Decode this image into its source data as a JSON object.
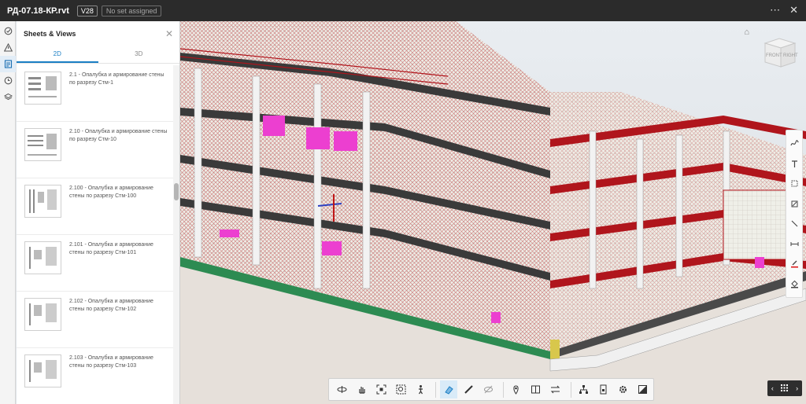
{
  "header": {
    "file_name": "РД-07.18-КР.rvt",
    "version": "V28",
    "set_status": "No set assigned",
    "more_icon": "more-horizontal-icon",
    "close_icon": "close-icon"
  },
  "rail": {
    "icons": [
      "check-circle-icon",
      "warning-icon",
      "sheets-icon",
      "history-icon",
      "layers-icon"
    ],
    "active": "sheets-icon"
  },
  "panel": {
    "title": "Sheets & Views",
    "tabs": [
      {
        "label": "2D",
        "active": true
      },
      {
        "label": "3D",
        "active": false
      }
    ],
    "items": [
      {
        "label": "2.1 - Опалубка и армирование стены по разрезу Стм-1"
      },
      {
        "label": "2.10 - Опалубка и армирование стены по разрезу Стм-10"
      },
      {
        "label": "2.100 - Опалубка и армирование стены по разрезу Стм-100"
      },
      {
        "label": "2.101 - Опалубка и армирование стены по разрезу Стм-101"
      },
      {
        "label": "2.102 - Опалубка и армирование стены по разрезу Стм-102"
      },
      {
        "label": "2.103 - Опалубка и армирование стены по разрезу Стм-103"
      }
    ]
  },
  "viewcube": {
    "front": "FRONT",
    "right": "RIGHT"
  },
  "markup_tools": [
    "freehand-icon",
    "text-icon",
    "rectangle-icon",
    "polygon-icon",
    "line-icon",
    "dimension-icon",
    "pen-color-icon",
    "fill-icon"
  ],
  "toolbar": {
    "groups": [
      [
        "orbit-icon",
        "pan-icon",
        "fit-view-icon",
        "zoom-window-icon",
        "first-person-icon"
      ],
      [
        "section-icon",
        "measure-icon",
        "hide-icon"
      ],
      [
        "location-icon",
        "sheet-compare-icon",
        "swap-icon"
      ],
      [
        "model-tree-icon",
        "properties-icon",
        "settings-icon",
        "fullscreen-icon"
      ]
    ],
    "active": "section-icon"
  },
  "pager": {
    "prev_icon": "chevron-left-icon",
    "grid_icon": "grid-icon",
    "next_icon": "chevron-right-icon"
  },
  "colors": {
    "accent": "#1b7fc4",
    "topbar": "#2b2b2b",
    "rebar": "#b0151c",
    "wall": "#efefe8",
    "magenta": "#ec3fd0"
  }
}
